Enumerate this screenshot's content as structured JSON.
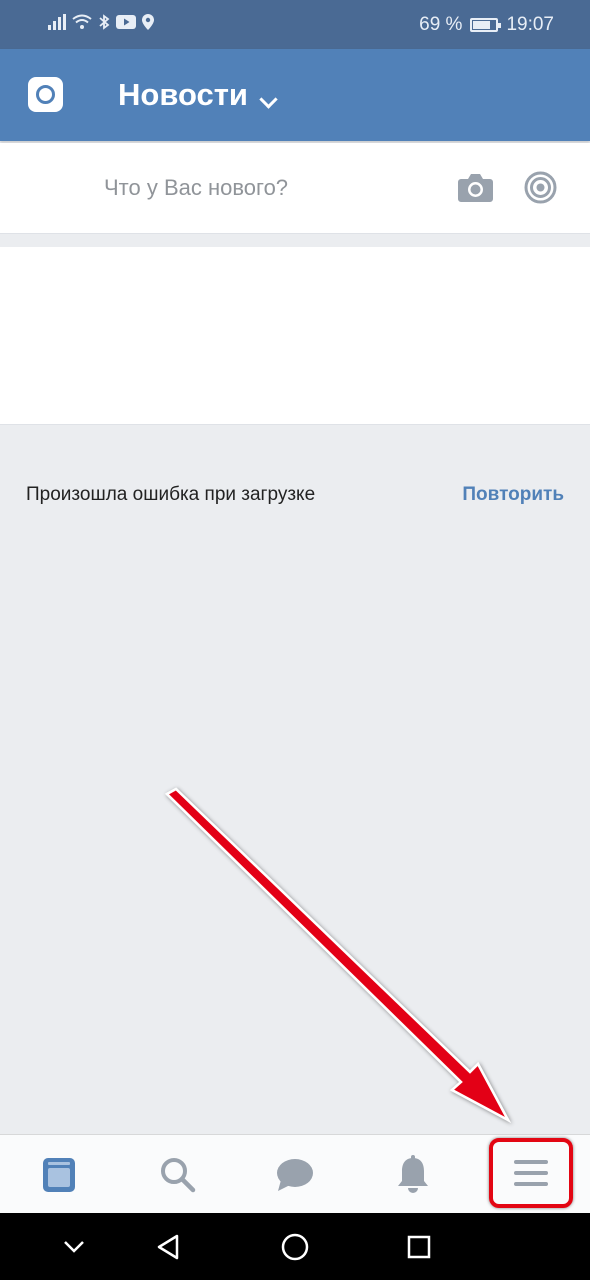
{
  "status_bar": {
    "battery": "69 %",
    "battery_level": 0.69,
    "time": "19:07"
  },
  "header": {
    "title": "Новости"
  },
  "composer": {
    "placeholder": "Что у Вас нового?"
  },
  "feed": {
    "error_text": "Произошла ошибка при загрузке",
    "retry_label": "Повторить"
  },
  "tabs": [
    {
      "name": "news",
      "icon": "news-icon",
      "active": true
    },
    {
      "name": "search",
      "icon": "search-icon",
      "active": false
    },
    {
      "name": "messages",
      "icon": "messages-icon",
      "active": false
    },
    {
      "name": "notifications",
      "icon": "bell-icon",
      "active": false
    },
    {
      "name": "menu",
      "icon": "menu-icon",
      "active": false
    }
  ],
  "colors": {
    "appbar": "#5181b8",
    "statusbar": "#4a6a94",
    "accent": "#5181b8",
    "highlight": "#e30613",
    "background": "#ebedf0"
  }
}
